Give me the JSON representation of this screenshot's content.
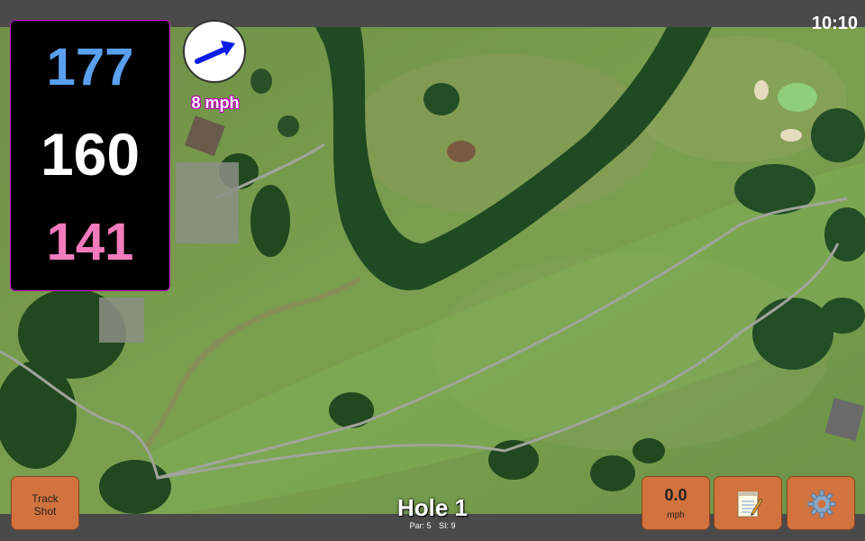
{
  "status": {
    "time": "10:10"
  },
  "distances": {
    "back": "177",
    "middle": "160",
    "front": "141"
  },
  "wind": {
    "speed_label": "8 mph",
    "arrow_icon": "wind-arrow-icon",
    "arrow_color": "#0a1ee6"
  },
  "hole": {
    "title": "Hole 1",
    "par_label": "Par: 5",
    "si_label": "SI: 9"
  },
  "buttons": {
    "track_shot_line1": "Track",
    "track_shot_line2": "Shot",
    "speed_value": "0.0",
    "speed_unit": "mph",
    "notes_icon": "notepad-icon",
    "settings_icon": "gear-icon"
  },
  "colors": {
    "button_bg": "#d2723e",
    "back_dist": "#5aa0ee",
    "front_dist": "#f37bbd",
    "mid_dist": "#ffffff"
  }
}
